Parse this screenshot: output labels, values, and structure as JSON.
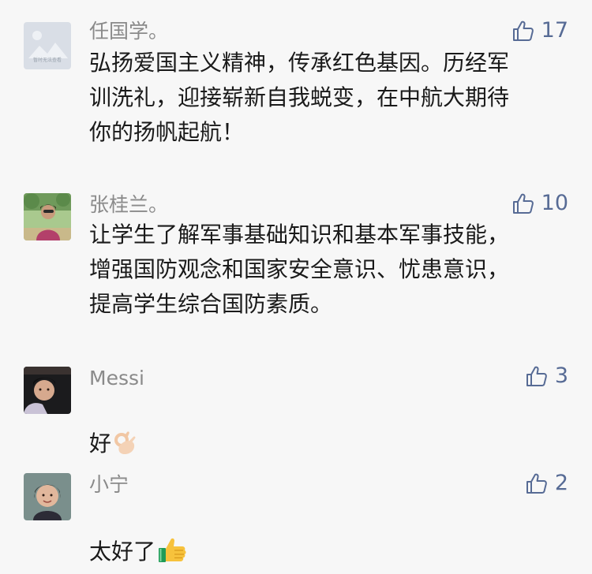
{
  "comments": [
    {
      "name": "任国学。",
      "likes": "17",
      "text": "弘扬爱国主义精神，传承红色基因。历经军\n训洗礼，迎接崭新自我蜕变，在中航大期待\n你的扬帆起航！",
      "avatar": "placeholder-image-avatar",
      "avatar_caption": "暂时无法查看"
    },
    {
      "name": "张桂兰。",
      "likes": "10",
      "text": "让学生了解军事基础知识和基本军事技能，\n增强国防观念和国家安全意识、忧患意识，\n提高学生综合国防素质。",
      "avatar": "photo-woman-outdoors"
    },
    {
      "name": "Messi",
      "likes": "3",
      "text": "好",
      "emoji": "ok-hand-emoji",
      "avatar": "photo-young-man"
    },
    {
      "name": "小宁",
      "likes": "2",
      "text": "太好了",
      "emoji": "thumbs-up-emoji",
      "avatar": "photo-young-woman"
    }
  ],
  "colors": {
    "background": "#f7f7f7",
    "name": "#8a8a8a",
    "like": "#576b95",
    "text": "#1a1a1a"
  }
}
